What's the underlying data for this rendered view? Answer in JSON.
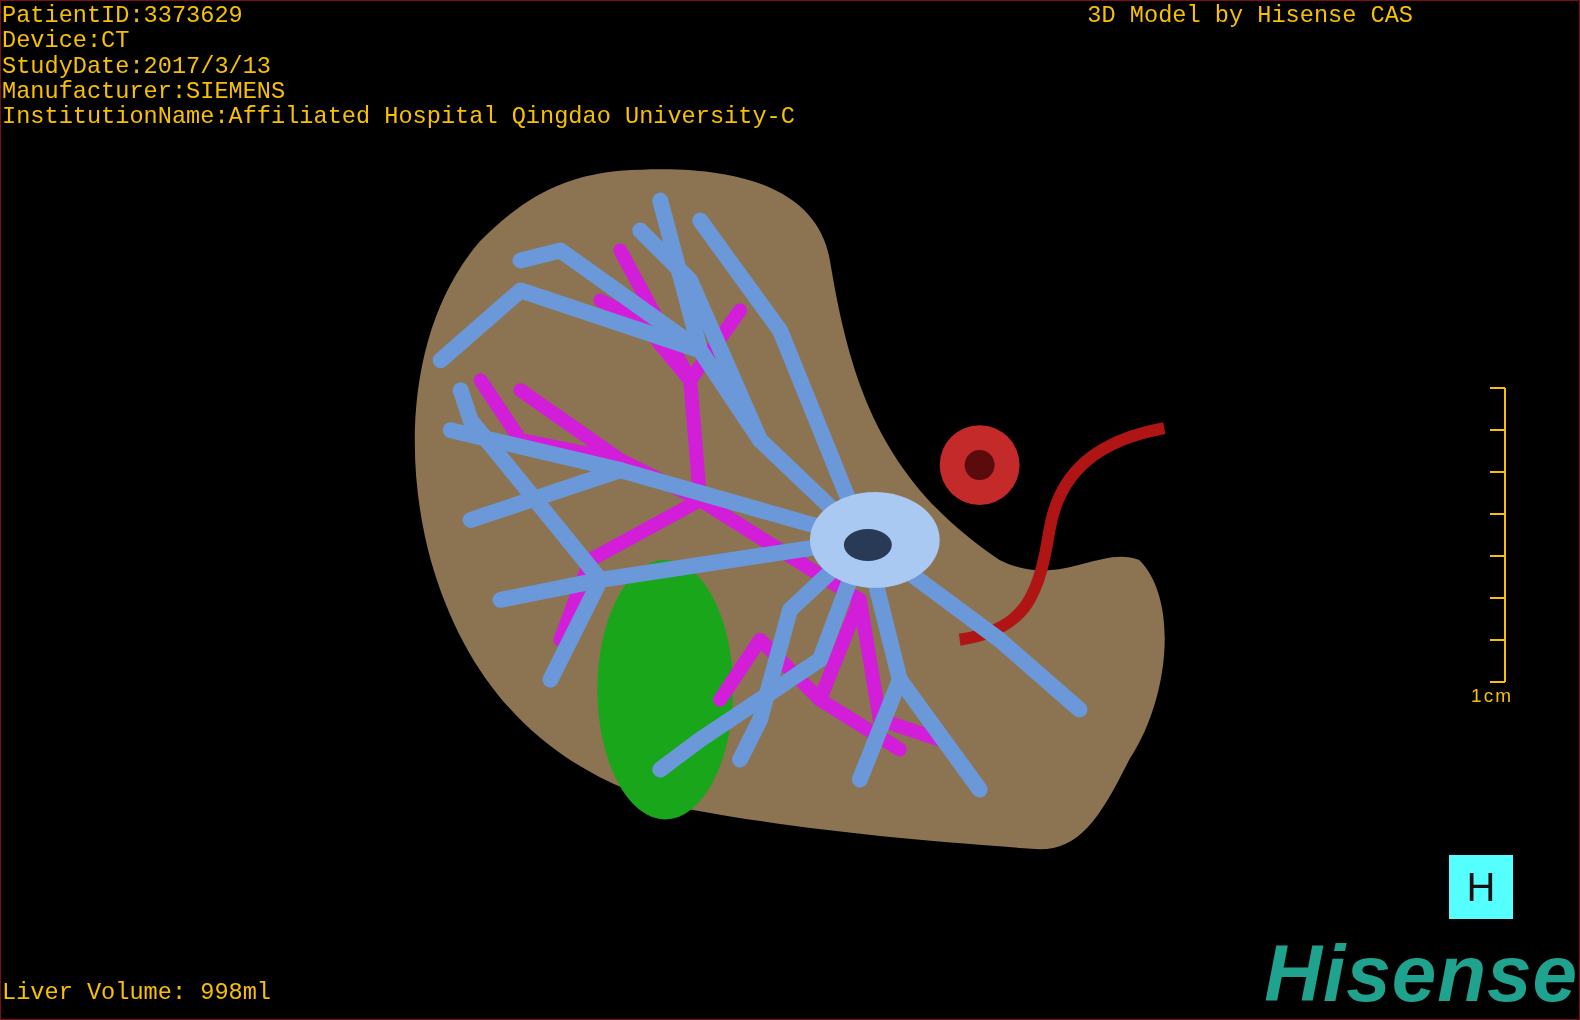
{
  "study_info": [
    "PatientID:3373629",
    "Device:CT",
    "StudyDate:2017/3/13",
    "Manufacturer:SIEMENS",
    "InstitutionName:Affiliated Hospital Qingdao University-C"
  ],
  "title": "3D Model by Hisense CAS",
  "scale_bar": {
    "label": "1cm"
  },
  "view_button": "H",
  "logo": "Hisense",
  "liver_volume": "Liver Volume: 998ml"
}
